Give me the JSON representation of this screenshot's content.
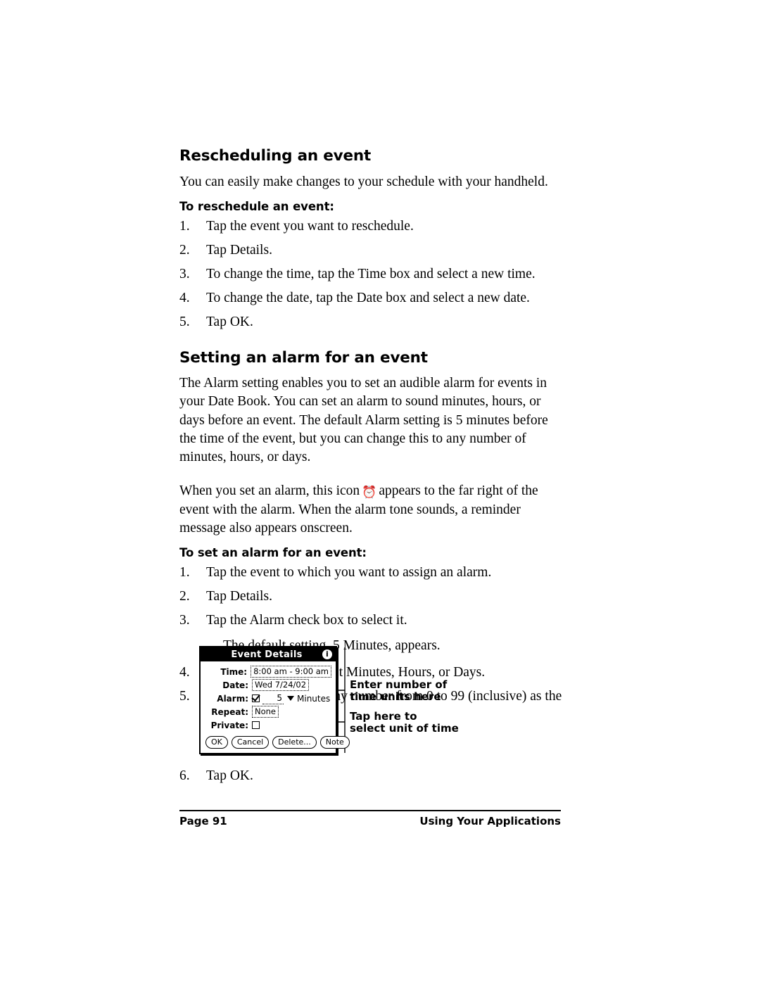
{
  "document": {
    "sections": [
      {
        "heading": "Rescheduling an event",
        "intro": "You can easily make changes to your schedule with your handheld.",
        "subhead": "To reschedule an event:",
        "steps": [
          {
            "num": "1.",
            "text": "Tap the event you want to reschedule."
          },
          {
            "num": "2.",
            "text": "Tap Details."
          },
          {
            "num": "3.",
            "text": "To change the time, tap the Time box and select a new time."
          },
          {
            "num": "4.",
            "text": "To change the date, tap the Date box and select a new date."
          },
          {
            "num": "5.",
            "text": "Tap OK."
          }
        ]
      },
      {
        "heading": "Setting an alarm for an event",
        "para1": "The Alarm setting enables you to set an audible alarm for events in your Date Book. You can set an alarm to sound minutes, hours, or days before an event. The default Alarm setting is 5 minutes before the time of the event, but you can change this to any number of minutes, hours, or days.",
        "para2_before": "When you set an alarm, this icon",
        "para2_icon": "alarm-clock-icon",
        "para2_glyph": "⏰",
        "para2_after": "appears to the far right of the event with the alarm. When the alarm tone sounds, a reminder message also appears onscreen.",
        "subhead": "To set an alarm for an event:",
        "steps": [
          {
            "num": "1.",
            "text": "Tap the event to which you want to assign an alarm."
          },
          {
            "num": "2.",
            "text": "Tap Details."
          },
          {
            "num": "3.",
            "text": "Tap the Alarm check box to select it."
          }
        ],
        "note": "The default setting, 5 Minutes, appears.",
        "steps2": [
          {
            "num": "4.",
            "text": "Tap the pick list to select Minutes, Hours, or Days."
          },
          {
            "num": "5.",
            "text": "Select the 5 and enter any number from 0 to 99 (inclusive) as the number of time units."
          }
        ],
        "final_step": {
          "num": "6.",
          "text": "Tap OK."
        }
      }
    ]
  },
  "figure": {
    "dialog": {
      "title": "Event Details",
      "info_icon": "i",
      "fields": [
        {
          "label": "Time:",
          "value": "8:00 am - 9:00 am"
        },
        {
          "label": "Date:",
          "value": "Wed 7/24/02"
        },
        {
          "label": "Alarm:",
          "value": "5",
          "unit": "Minutes"
        },
        {
          "label": "Repeat:",
          "value": "None"
        },
        {
          "label": "Private:",
          "value": ""
        }
      ],
      "buttons": [
        {
          "label": "OK"
        },
        {
          "label": "Cancel"
        },
        {
          "label": "Delete..."
        },
        {
          "label": "Note"
        }
      ]
    },
    "callouts": [
      {
        "line1": "Enter number of",
        "line2": "time units here"
      },
      {
        "line1": "Tap here to",
        "line2": "select unit of time"
      }
    ]
  },
  "footer": {
    "page": "Page 91",
    "title": "Using Your Applications"
  }
}
